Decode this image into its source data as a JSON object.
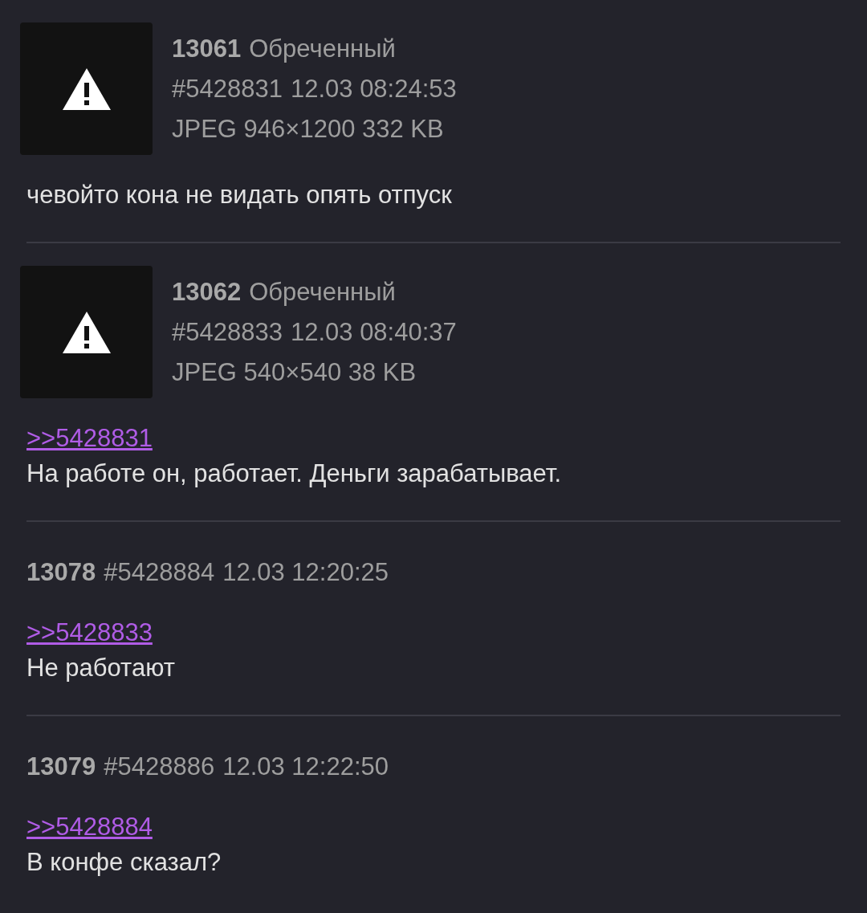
{
  "posts": [
    {
      "number": "13061",
      "name": "Обреченный",
      "post_id": "#5428831",
      "datetime": "12.03 08:24:53",
      "file": {
        "kind": "broken",
        "info": "JPEG 946×1200 332 KB"
      },
      "body": [
        {
          "kind": "text",
          "text": "чевойто кона не видать опять отпуск"
        }
      ]
    },
    {
      "number": "13062",
      "name": "Обреченный",
      "post_id": "#5428833",
      "datetime": "12.03 08:40:37",
      "file": {
        "kind": "broken",
        "info": "JPEG 540×540 38 KB"
      },
      "body": [
        {
          "kind": "reply",
          "text": ">>5428831"
        },
        {
          "kind": "text",
          "text": "На работе он, работает. Деньги зарабатывает."
        }
      ]
    },
    {
      "number": "13078",
      "post_id": "#5428884",
      "datetime": "12.03 12:20:25",
      "body": [
        {
          "kind": "reply",
          "text": ">>5428833"
        },
        {
          "kind": "text",
          "text": "Не работают"
        }
      ]
    },
    {
      "number": "13079",
      "post_id": "#5428886",
      "datetime": "12.03 12:22:50",
      "body": [
        {
          "kind": "reply",
          "text": ">>5428884"
        },
        {
          "kind": "text",
          "text": "В конфе сказал?"
        }
      ]
    }
  ]
}
